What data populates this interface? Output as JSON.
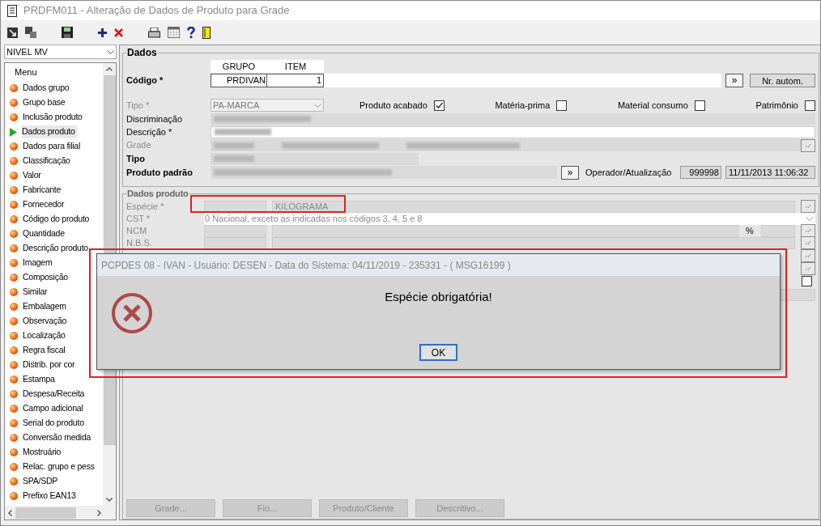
{
  "window": {
    "title": "PRDFM011 - Alteração de Dados de Produto para Grade"
  },
  "level_select": {
    "value": "NIVEL MV"
  },
  "menu": {
    "title": "Menu",
    "items": [
      {
        "label": "Dados grupo",
        "selected": false
      },
      {
        "label": "Grupo base",
        "selected": false
      },
      {
        "label": "Inclusão produto",
        "selected": false
      },
      {
        "label": "Dados produto",
        "selected": true
      },
      {
        "label": "Dados para filial",
        "selected": false
      },
      {
        "label": "Classificação",
        "selected": false
      },
      {
        "label": "Valor",
        "selected": false
      },
      {
        "label": "Fabricante",
        "selected": false
      },
      {
        "label": "Fornecedor",
        "selected": false
      },
      {
        "label": "Código do produto",
        "selected": false
      },
      {
        "label": "Quantidade",
        "selected": false
      },
      {
        "label": "Descrição produto",
        "selected": false
      },
      {
        "label": "Imagem",
        "selected": false
      },
      {
        "label": "Composição",
        "selected": false
      },
      {
        "label": "Similar",
        "selected": false
      },
      {
        "label": "Embalagem",
        "selected": false
      },
      {
        "label": "Observação",
        "selected": false
      },
      {
        "label": "Localização",
        "selected": false
      },
      {
        "label": "Regra fiscal",
        "selected": false
      },
      {
        "label": "Distrib. por cor",
        "selected": false
      },
      {
        "label": "Estampa",
        "selected": false
      },
      {
        "label": "Despesa/Receita",
        "selected": false
      },
      {
        "label": "Campo adicional",
        "selected": false
      },
      {
        "label": "Serial do produto",
        "selected": false
      },
      {
        "label": "Conversão medida",
        "selected": false
      },
      {
        "label": "Mostruário",
        "selected": false
      },
      {
        "label": "Relac. grupo e pess",
        "selected": false
      },
      {
        "label": "SPA/SDP",
        "selected": false
      },
      {
        "label": "Prefixo EAN13",
        "selected": false
      }
    ]
  },
  "dados": {
    "title": "Dados",
    "codigo": {
      "label": "Código *",
      "columns": [
        "GRUPO",
        "ITEM"
      ],
      "grupo": "PRDIVAN",
      "item": "1"
    },
    "next_button": "»",
    "auto_button": "Nr. autom.",
    "tipo": {
      "label": "Tipo *",
      "value": "PA-MARCA",
      "disabled": true
    },
    "checks": [
      {
        "label": "Produto acabado",
        "checked": true
      },
      {
        "label": "Matéria-prima",
        "checked": false
      },
      {
        "label": "Material consumo",
        "checked": false
      },
      {
        "label": "Patrimônio",
        "checked": false
      }
    ],
    "discriminacao": {
      "label": "Discriminação",
      "disabled": false
    },
    "descricao": {
      "label": "Descrição *",
      "disabled": false
    },
    "grade": {
      "label": "Grade",
      "disabled": true
    },
    "tipo2": {
      "label": "Tipo",
      "disabled": false
    },
    "produto_padrao": {
      "label": "Produto padrão",
      "button": "»"
    },
    "operador": {
      "label": "Operador/Atualização",
      "code": "999998",
      "date": "11/11/2013 11:06:32"
    }
  },
  "dados_produto": {
    "title": "Dados produto",
    "especie": {
      "label": "Espécie *",
      "value": "KILOGRAMA",
      "disabled": true
    },
    "cst": {
      "label": "CST *",
      "value": "0 Nacional, exceto as indicadas nos códigos 3, 4, 5 e 8",
      "disabled": true
    },
    "ncm": {
      "label": "NCM",
      "unit": "%",
      "disabled": true
    },
    "nbs": {
      "label": "N.B.S.",
      "disabled": true
    },
    "row_8_checkbox": {
      "checked": false
    }
  },
  "dialog": {
    "title": "PCPDES 08 - IVAN - Usuário: DESEN - Data do Sistema: 04/11/2019 - 235331 - ( MSG16199 )",
    "message": "Espécie obrigatória!",
    "ok": "OK"
  },
  "buttons": [
    {
      "label": "Grade...",
      "disabled": true
    },
    {
      "label": "Fio...",
      "disabled": true
    },
    {
      "label": "Produto/Cliente",
      "disabled": true
    },
    {
      "label": "Descritivo...",
      "disabled": true
    }
  ]
}
